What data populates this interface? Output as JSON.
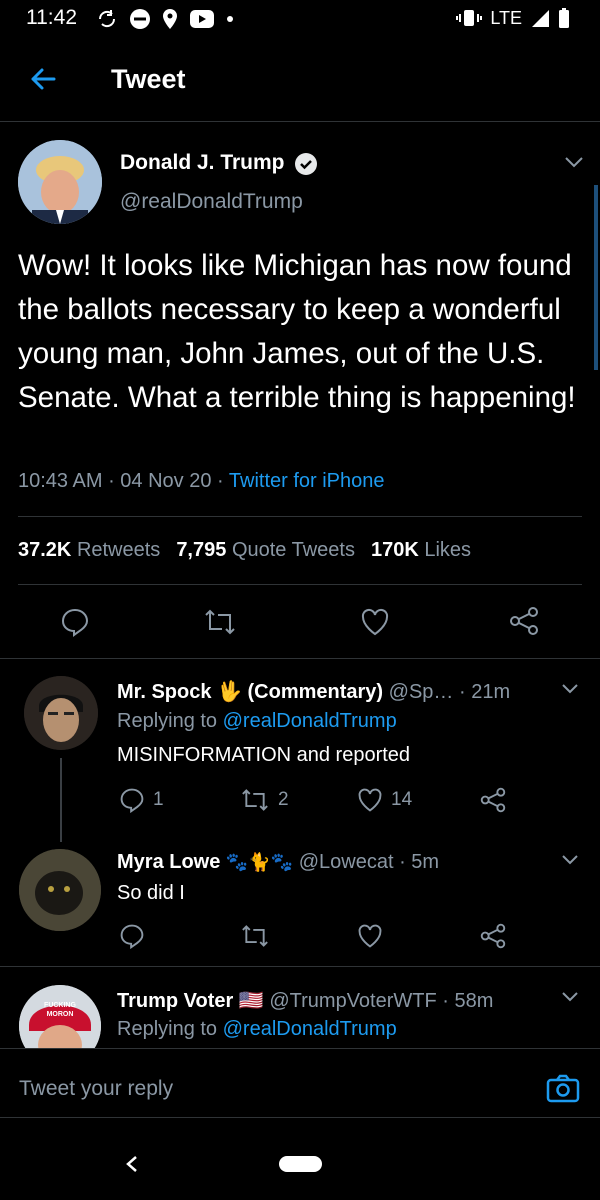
{
  "status_bar": {
    "time": "11:42",
    "network": "LTE"
  },
  "header": {
    "title": "Tweet"
  },
  "main_tweet": {
    "author_name": "Donald J. Trump",
    "handle": "@realDonaldTrump",
    "text": "Wow! It looks like Michigan has now found the ballots necessary to keep a wonderful young man, John James, out of the U.S. Senate. What a terrible thing is happening!",
    "time": "10:43 AM",
    "date": "04 Nov 20",
    "source": "Twitter for iPhone",
    "retweets_count": "37.2K",
    "retweets_label": "Retweets",
    "quotes_count": "7,795",
    "quotes_label": "Quote Tweets",
    "likes_count": "170K",
    "likes_label": "Likes"
  },
  "replies": [
    {
      "name": "Mr. Spock",
      "name_suffix": "(Commentary)",
      "handle": "@Sp…",
      "time": "· 21m",
      "replying_label": "Replying to",
      "replying_to": "@realDonaldTrump",
      "text": "MISINFORMATION and reported",
      "reply_count": "1",
      "retweet_count": "2",
      "like_count": "14"
    },
    {
      "name": "Myra Lowe",
      "handle": "@Lowecat",
      "time": "· 5m",
      "text": "So did I"
    },
    {
      "name": "Trump Voter",
      "handle": "@TrumpVoterWTF",
      "time": "· 58m",
      "replying_label": "Replying to",
      "replying_to": "@realDonaldTrump",
      "avatar_hat_text": "FUCKING MORON"
    }
  ],
  "reply_box": {
    "placeholder": "Tweet your reply"
  },
  "colors": {
    "accent": "#1d9bf0",
    "background": "#000000",
    "muted": "#8b98a5"
  }
}
